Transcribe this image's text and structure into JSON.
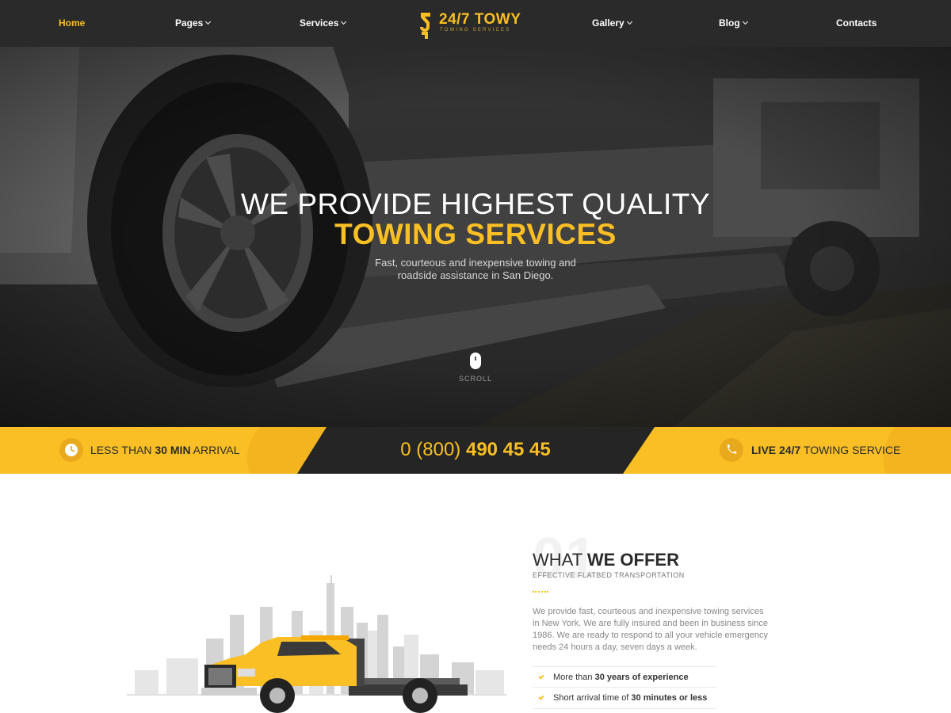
{
  "nav": {
    "items": [
      {
        "label": "Home",
        "active": true
      },
      {
        "label": "Pages",
        "dropdown": true
      },
      {
        "label": "Services",
        "dropdown": true
      },
      {
        "label": "Gallery",
        "dropdown": true
      },
      {
        "label": "Blog",
        "dropdown": true
      },
      {
        "label": "Contacts"
      }
    ],
    "logo": {
      "title": "24/7 TOWY",
      "tagline": "TOWING SERVICES"
    }
  },
  "hero": {
    "title_line1": "WE PROVIDE HIGHEST QUALITY",
    "title_line2": "TOWING SERVICES",
    "subtitle": "Fast, courteous and inexpensive towing and roadside assistance in San Diego.",
    "scroll_label": "SCROLL"
  },
  "band": {
    "left": {
      "prefix": "LESS THAN ",
      "highlight": "30 MIN",
      "suffix": " ARRIVAL",
      "icon": "clock-icon"
    },
    "phone": {
      "prefix": "0 (800) ",
      "number": "490 45 45"
    },
    "right": {
      "highlight": "LIVE 24/7",
      "suffix": " TOWING SERVICE",
      "icon": "phone-icon"
    }
  },
  "offer": {
    "number": "01",
    "title_light": "WHAT ",
    "title_bold": "WE OFFER",
    "subtitle": "EFFECTIVE FLATBED TRANSPORTATION",
    "paragraph": "We provide fast, courteous and inexpensive towing services in New York. We are fully insured and been in business since 1986. We are ready to respond to all your vehicle emergency needs 24 hours a day, seven days a week.",
    "features": [
      {
        "prefix": "More than ",
        "bold": "30 years of experience"
      },
      {
        "prefix": "Short arrival time of ",
        "bold": "30 minutes or less"
      }
    ]
  },
  "colors": {
    "accent": "#f9bf24",
    "dark": "#2a2a2a"
  }
}
